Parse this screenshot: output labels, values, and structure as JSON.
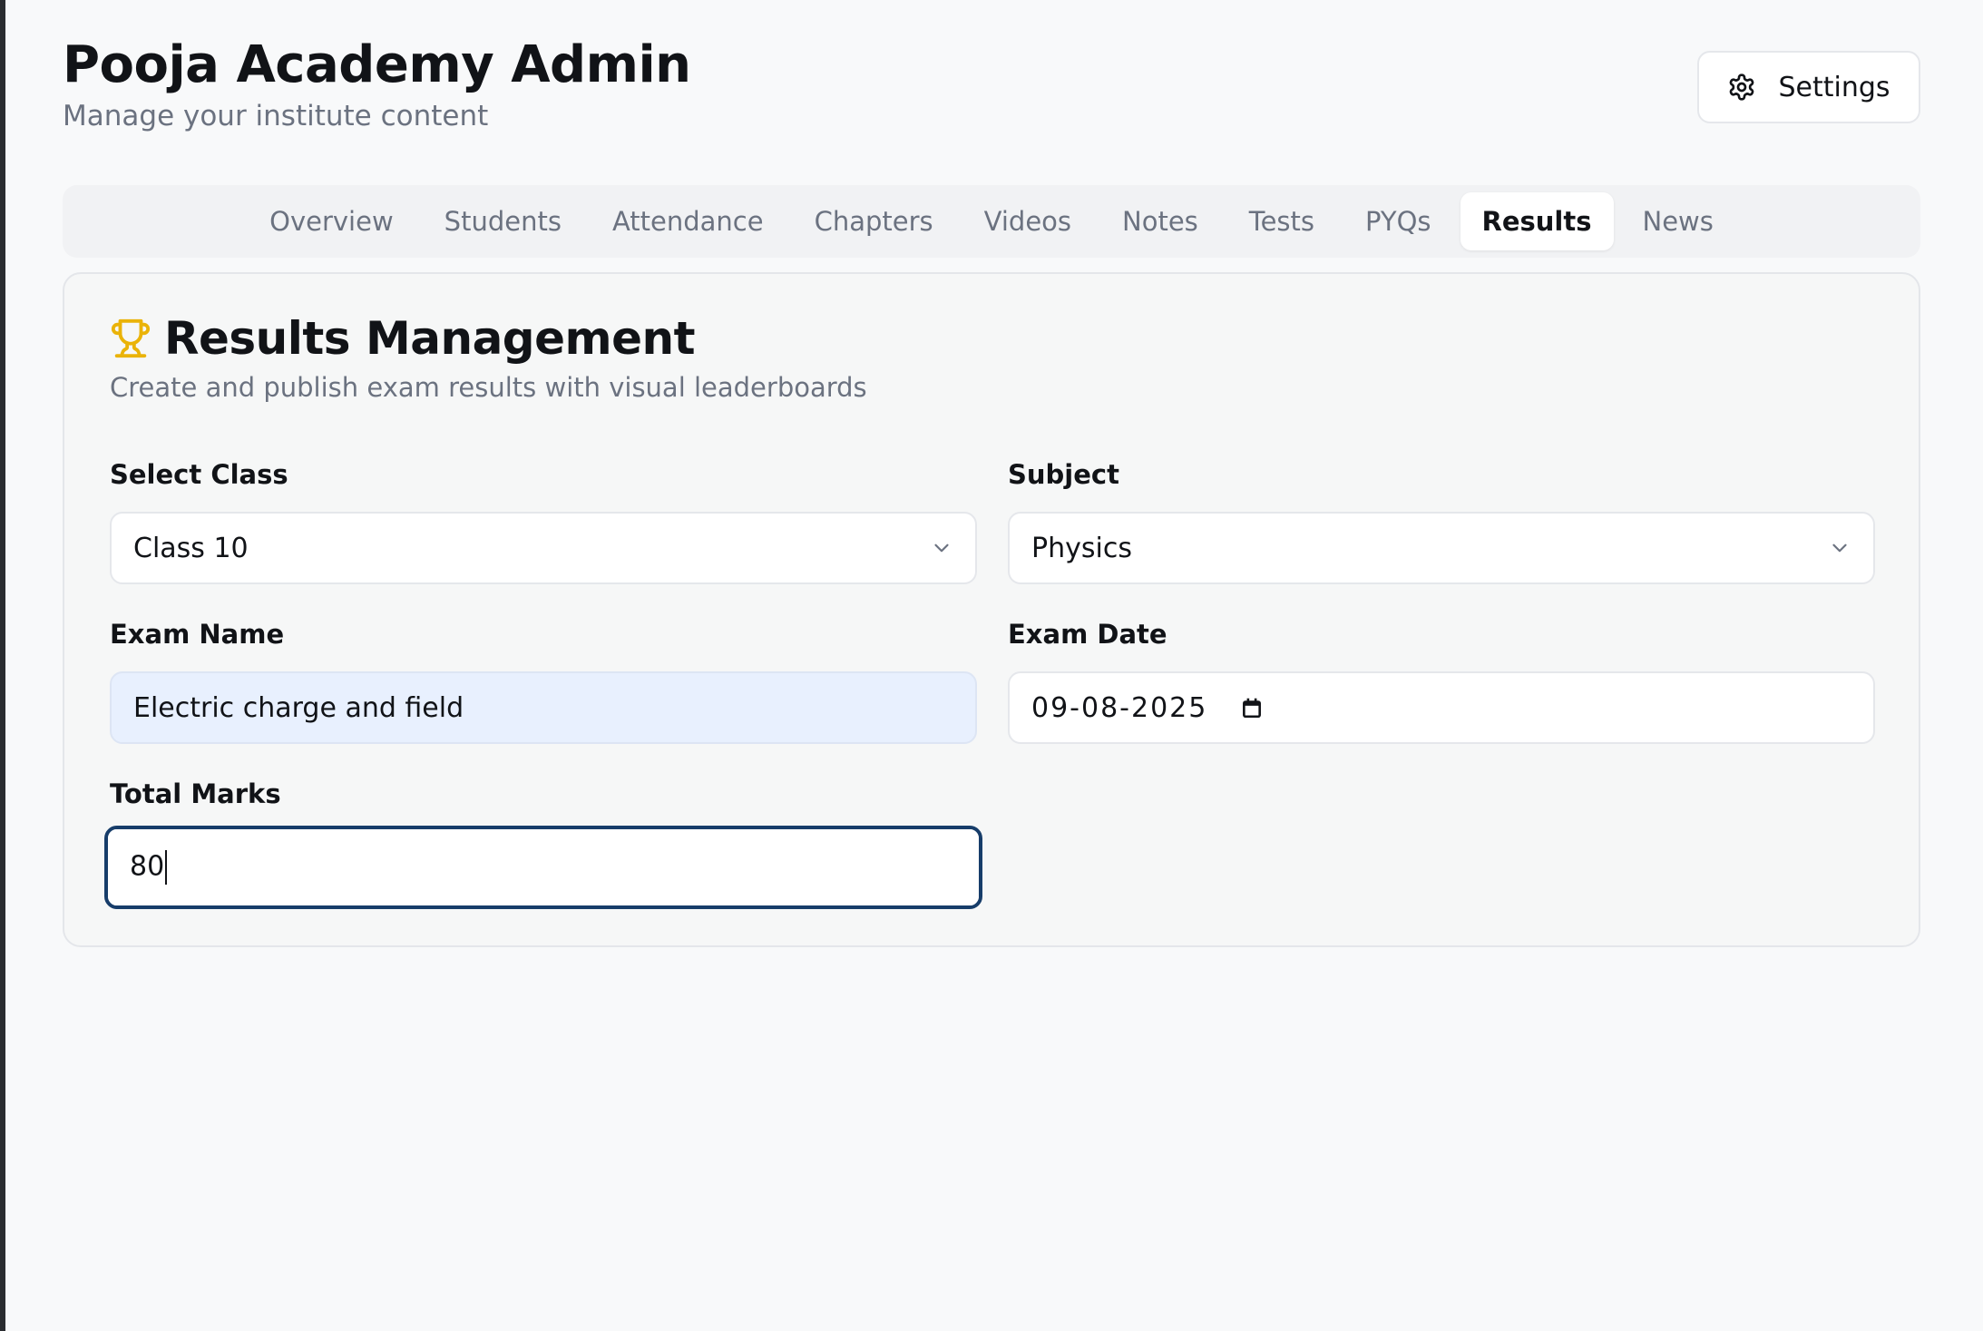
{
  "header": {
    "title": "Pooja Academy Admin",
    "subtitle": "Manage your institute content",
    "settings_label": "Settings",
    "settings_icon": "gear-icon"
  },
  "tabs": [
    {
      "label": "Overview",
      "active": false
    },
    {
      "label": "Students",
      "active": false
    },
    {
      "label": "Attendance",
      "active": false
    },
    {
      "label": "Chapters",
      "active": false
    },
    {
      "label": "Videos",
      "active": false
    },
    {
      "label": "Notes",
      "active": false
    },
    {
      "label": "Tests",
      "active": false
    },
    {
      "label": "PYQs",
      "active": false
    },
    {
      "label": "Results",
      "active": true
    },
    {
      "label": "News",
      "active": false
    }
  ],
  "card": {
    "icon": "trophy-icon",
    "icon_color": "#eab308",
    "title": "Results Management",
    "subtitle": "Create and publish exam results with visual leaderboards"
  },
  "form": {
    "select_class": {
      "label": "Select Class",
      "value": "Class 10"
    },
    "subject": {
      "label": "Subject",
      "value": "Physics"
    },
    "exam_name": {
      "label": "Exam Name",
      "value": "Electric charge and field"
    },
    "exam_date": {
      "label": "Exam Date",
      "value": "09-08-2025"
    },
    "total_marks": {
      "label": "Total Marks",
      "value": "80"
    }
  },
  "colors": {
    "background": "#f8f9fa",
    "focus_ring": "#173d6a",
    "autofill_bg": "#e8f0fe"
  }
}
